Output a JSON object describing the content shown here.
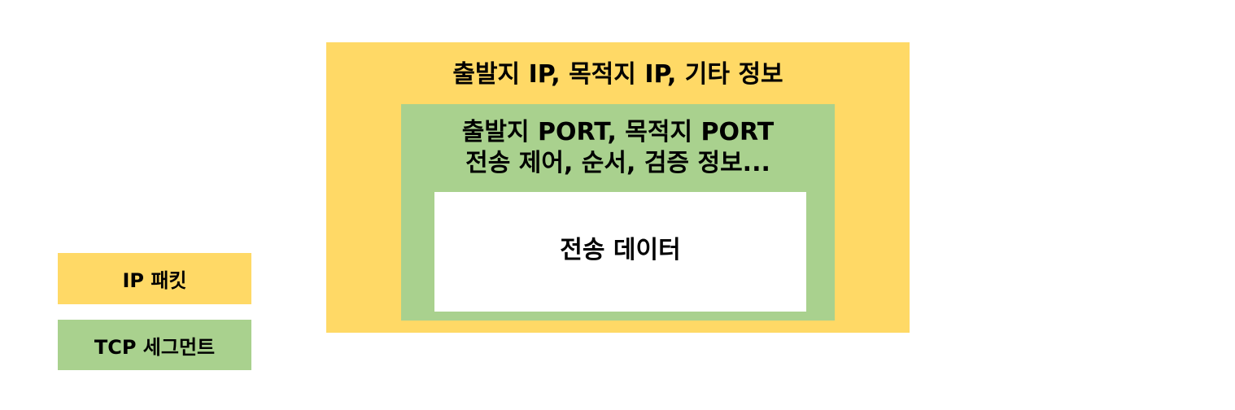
{
  "ip_packet": {
    "header": "출발지 IP, 목적지 IP, 기타 정보"
  },
  "tcp_segment": {
    "header_line1": "출발지 PORT, 목적지 PORT",
    "header_line2": "전송 제어, 순서, 검증 정보..."
  },
  "payload": {
    "label": "전송 데이터"
  },
  "legend": {
    "ip_label": "IP 패킷",
    "tcp_label": "TCP 세그먼트"
  },
  "colors": {
    "ip_packet": "#ffd966",
    "tcp_segment": "#a9d18e",
    "payload": "#ffffff"
  }
}
